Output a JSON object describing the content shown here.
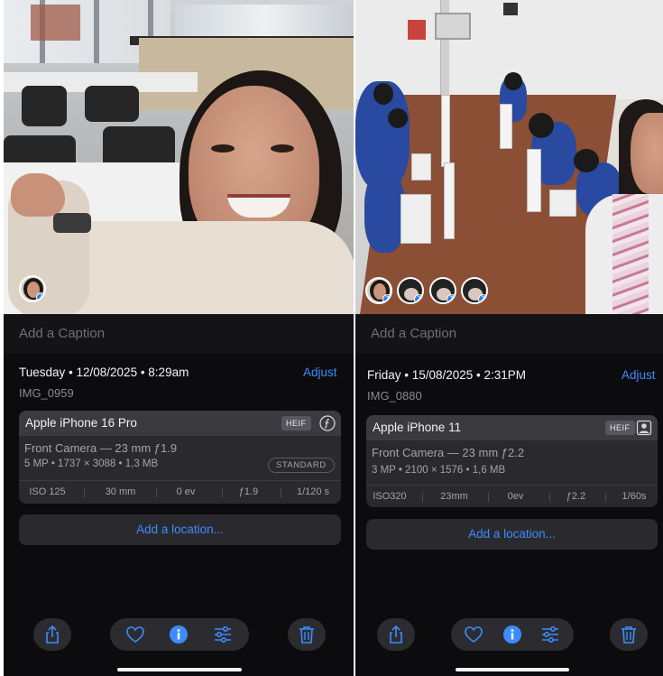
{
  "screens": [
    {
      "caption_placeholder": "Add a Caption",
      "datetime": "Tuesday • 12/08/2025 • 8:29am",
      "adjust_label": "Adjust",
      "filename": "IMG_0959",
      "device": "Apple iPhone 16 Pro",
      "format_badge": "HEIF",
      "format_icon": "f-circle-icon",
      "lens": "Front Camera — 23 mm ƒ1.9",
      "specs": "5 MP • 1737 × 3088 • 1,3 MB",
      "style_badge": "STANDARD",
      "exif": [
        "ISO 125",
        "30 mm",
        "0 ev",
        "ƒ1.9",
        "1/120 s"
      ],
      "location_label": "Add a location...",
      "people_count": 1
    },
    {
      "caption_placeholder": "Add a Caption",
      "datetime": "Friday • 15/08/2025 • 2:31PM",
      "adjust_label": "Adjust",
      "filename": "IMG_0880",
      "device": "Apple iPhone 11",
      "format_badge": "HEIF",
      "format_icon": "portrait-icon",
      "lens": "Front Camera — 23 mm ƒ2.2",
      "specs": "3 MP • 2100 × 1576 • 1,6 MB",
      "exif": [
        "ISO320",
        "23mm",
        "0ev",
        "ƒ2.2",
        "1/60s"
      ],
      "location_label": "Add a location...",
      "people_count": 4
    }
  ],
  "toolbar_icons": [
    "share-icon",
    "heart-icon",
    "info-icon",
    "adjust-sliders-icon",
    "trash-icon"
  ],
  "colors": {
    "background": "#0c0c0e",
    "accent": "#3c8cff",
    "card": "#2a2a2e",
    "card_header": "#3a3a3f"
  }
}
